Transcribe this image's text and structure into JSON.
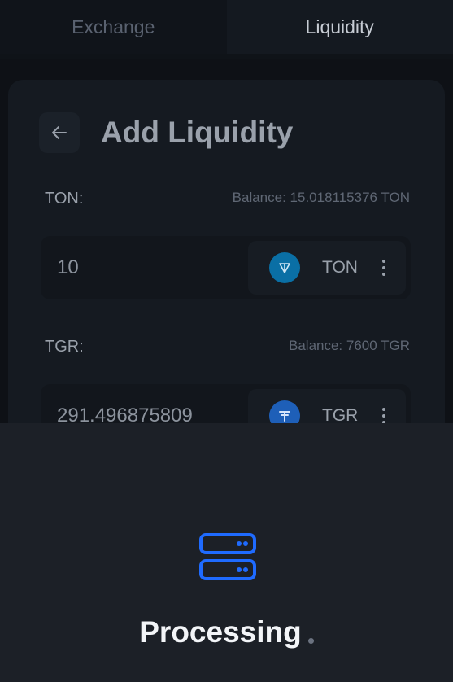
{
  "tabs": [
    {
      "label": "Exchange",
      "active": false
    },
    {
      "label": "Liquidity",
      "active": true
    }
  ],
  "page": {
    "title": "Add Liquidity",
    "back_icon": "arrow-left-icon"
  },
  "inputs": [
    {
      "label": "TON:",
      "balance": "Balance: 15.018115376 TON",
      "value": "10",
      "token": "TON",
      "logo_icon": "ton-logo-icon",
      "logo_color": "#0a6fa5"
    },
    {
      "label": "TGR:",
      "balance": "Balance: 7600 TGR",
      "value": "291.496875809",
      "token": "TGR",
      "logo_icon": "tgr-logo-icon",
      "logo_color": "#1e5fb8"
    }
  ],
  "overlay": {
    "status_text": "Processing",
    "icon": "server-icon",
    "accent_color": "#1f6bff"
  }
}
